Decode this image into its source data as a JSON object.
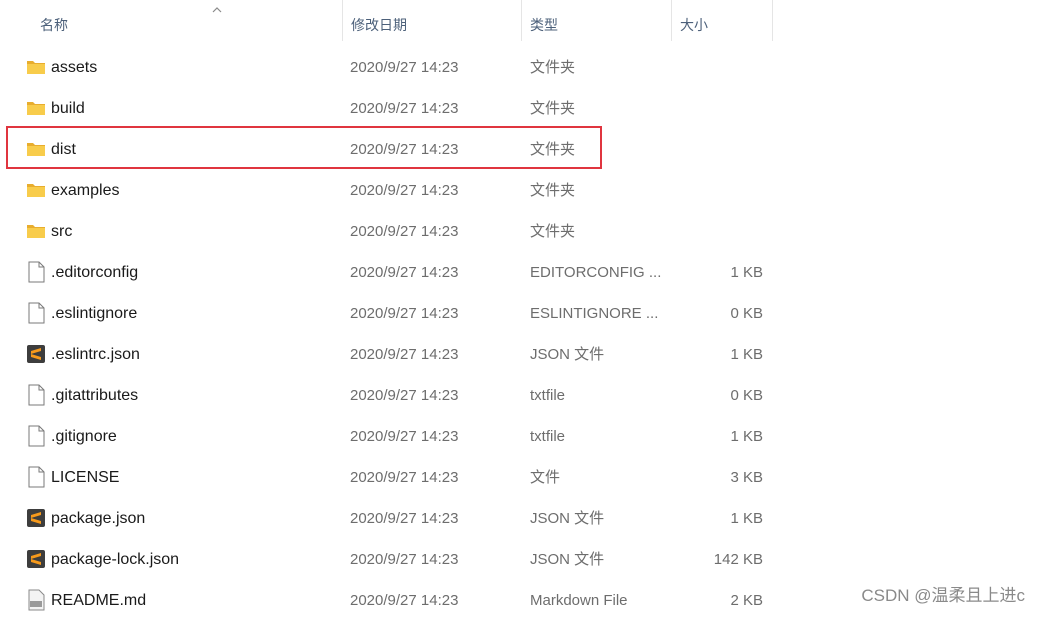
{
  "columns": {
    "name": "名称",
    "date": "修改日期",
    "type": "类型",
    "size": "大小"
  },
  "files": [
    {
      "name": "assets",
      "date": "2020/9/27 14:23",
      "type": "文件夹",
      "size": "",
      "icon": "folder-icon"
    },
    {
      "name": "build",
      "date": "2020/9/27 14:23",
      "type": "文件夹",
      "size": "",
      "icon": "folder-icon"
    },
    {
      "name": "dist",
      "date": "2020/9/27 14:23",
      "type": "文件夹",
      "size": "",
      "icon": "folder-icon"
    },
    {
      "name": "examples",
      "date": "2020/9/27 14:23",
      "type": "文件夹",
      "size": "",
      "icon": "folder-icon"
    },
    {
      "name": "src",
      "date": "2020/9/27 14:23",
      "type": "文件夹",
      "size": "",
      "icon": "folder-icon"
    },
    {
      "name": ".editorconfig",
      "date": "2020/9/27 14:23",
      "type": "EDITORCONFIG ...",
      "size": "1 KB",
      "icon": "file-icon"
    },
    {
      "name": ".eslintignore",
      "date": "2020/9/27 14:23",
      "type": "ESLINTIGNORE ...",
      "size": "0 KB",
      "icon": "file-icon"
    },
    {
      "name": ".eslintrc.json",
      "date": "2020/9/27 14:23",
      "type": "JSON 文件",
      "size": "1 KB",
      "icon": "sublime-icon"
    },
    {
      "name": ".gitattributes",
      "date": "2020/9/27 14:23",
      "type": "txtfile",
      "size": "0 KB",
      "icon": "file-icon"
    },
    {
      "name": ".gitignore",
      "date": "2020/9/27 14:23",
      "type": "txtfile",
      "size": "1 KB",
      "icon": "file-icon"
    },
    {
      "name": "LICENSE",
      "date": "2020/9/27 14:23",
      "type": "文件",
      "size": "3 KB",
      "icon": "file-icon"
    },
    {
      "name": "package.json",
      "date": "2020/9/27 14:23",
      "type": "JSON 文件",
      "size": "1 KB",
      "icon": "sublime-icon"
    },
    {
      "name": "package-lock.json",
      "date": "2020/9/27 14:23",
      "type": "JSON 文件",
      "size": "142 KB",
      "icon": "sublime-icon"
    },
    {
      "name": "README.md",
      "date": "2020/9/27 14:23",
      "type": "Markdown File",
      "size": "2 KB",
      "icon": "markdown-icon"
    }
  ],
  "highlight_color": "#e0353f",
  "folder_color": "#f5c542",
  "watermark": "CSDN @温柔且上进c"
}
